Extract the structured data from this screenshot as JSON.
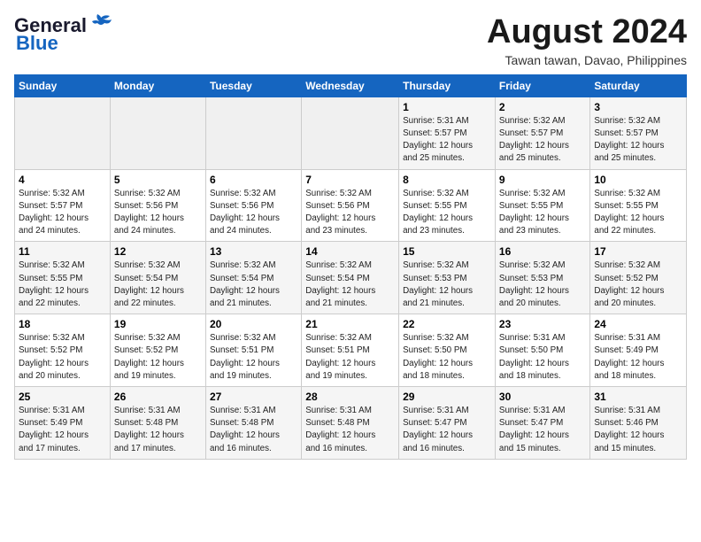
{
  "header": {
    "logo_general": "General",
    "logo_blue": "Blue",
    "month_year": "August 2024",
    "location": "Tawan tawan, Davao, Philippines"
  },
  "weekdays": [
    "Sunday",
    "Monday",
    "Tuesday",
    "Wednesday",
    "Thursday",
    "Friday",
    "Saturday"
  ],
  "weeks": [
    [
      {
        "day": "",
        "info": ""
      },
      {
        "day": "",
        "info": ""
      },
      {
        "day": "",
        "info": ""
      },
      {
        "day": "",
        "info": ""
      },
      {
        "day": "1",
        "info": "Sunrise: 5:31 AM\nSunset: 5:57 PM\nDaylight: 12 hours\nand 25 minutes."
      },
      {
        "day": "2",
        "info": "Sunrise: 5:32 AM\nSunset: 5:57 PM\nDaylight: 12 hours\nand 25 minutes."
      },
      {
        "day": "3",
        "info": "Sunrise: 5:32 AM\nSunset: 5:57 PM\nDaylight: 12 hours\nand 25 minutes."
      }
    ],
    [
      {
        "day": "4",
        "info": "Sunrise: 5:32 AM\nSunset: 5:57 PM\nDaylight: 12 hours\nand 24 minutes."
      },
      {
        "day": "5",
        "info": "Sunrise: 5:32 AM\nSunset: 5:56 PM\nDaylight: 12 hours\nand 24 minutes."
      },
      {
        "day": "6",
        "info": "Sunrise: 5:32 AM\nSunset: 5:56 PM\nDaylight: 12 hours\nand 24 minutes."
      },
      {
        "day": "7",
        "info": "Sunrise: 5:32 AM\nSunset: 5:56 PM\nDaylight: 12 hours\nand 23 minutes."
      },
      {
        "day": "8",
        "info": "Sunrise: 5:32 AM\nSunset: 5:55 PM\nDaylight: 12 hours\nand 23 minutes."
      },
      {
        "day": "9",
        "info": "Sunrise: 5:32 AM\nSunset: 5:55 PM\nDaylight: 12 hours\nand 23 minutes."
      },
      {
        "day": "10",
        "info": "Sunrise: 5:32 AM\nSunset: 5:55 PM\nDaylight: 12 hours\nand 22 minutes."
      }
    ],
    [
      {
        "day": "11",
        "info": "Sunrise: 5:32 AM\nSunset: 5:55 PM\nDaylight: 12 hours\nand 22 minutes."
      },
      {
        "day": "12",
        "info": "Sunrise: 5:32 AM\nSunset: 5:54 PM\nDaylight: 12 hours\nand 22 minutes."
      },
      {
        "day": "13",
        "info": "Sunrise: 5:32 AM\nSunset: 5:54 PM\nDaylight: 12 hours\nand 21 minutes."
      },
      {
        "day": "14",
        "info": "Sunrise: 5:32 AM\nSunset: 5:54 PM\nDaylight: 12 hours\nand 21 minutes."
      },
      {
        "day": "15",
        "info": "Sunrise: 5:32 AM\nSunset: 5:53 PM\nDaylight: 12 hours\nand 21 minutes."
      },
      {
        "day": "16",
        "info": "Sunrise: 5:32 AM\nSunset: 5:53 PM\nDaylight: 12 hours\nand 20 minutes."
      },
      {
        "day": "17",
        "info": "Sunrise: 5:32 AM\nSunset: 5:52 PM\nDaylight: 12 hours\nand 20 minutes."
      }
    ],
    [
      {
        "day": "18",
        "info": "Sunrise: 5:32 AM\nSunset: 5:52 PM\nDaylight: 12 hours\nand 20 minutes."
      },
      {
        "day": "19",
        "info": "Sunrise: 5:32 AM\nSunset: 5:52 PM\nDaylight: 12 hours\nand 19 minutes."
      },
      {
        "day": "20",
        "info": "Sunrise: 5:32 AM\nSunset: 5:51 PM\nDaylight: 12 hours\nand 19 minutes."
      },
      {
        "day": "21",
        "info": "Sunrise: 5:32 AM\nSunset: 5:51 PM\nDaylight: 12 hours\nand 19 minutes."
      },
      {
        "day": "22",
        "info": "Sunrise: 5:32 AM\nSunset: 5:50 PM\nDaylight: 12 hours\nand 18 minutes."
      },
      {
        "day": "23",
        "info": "Sunrise: 5:31 AM\nSunset: 5:50 PM\nDaylight: 12 hours\nand 18 minutes."
      },
      {
        "day": "24",
        "info": "Sunrise: 5:31 AM\nSunset: 5:49 PM\nDaylight: 12 hours\nand 18 minutes."
      }
    ],
    [
      {
        "day": "25",
        "info": "Sunrise: 5:31 AM\nSunset: 5:49 PM\nDaylight: 12 hours\nand 17 minutes."
      },
      {
        "day": "26",
        "info": "Sunrise: 5:31 AM\nSunset: 5:48 PM\nDaylight: 12 hours\nand 17 minutes."
      },
      {
        "day": "27",
        "info": "Sunrise: 5:31 AM\nSunset: 5:48 PM\nDaylight: 12 hours\nand 16 minutes."
      },
      {
        "day": "28",
        "info": "Sunrise: 5:31 AM\nSunset: 5:48 PM\nDaylight: 12 hours\nand 16 minutes."
      },
      {
        "day": "29",
        "info": "Sunrise: 5:31 AM\nSunset: 5:47 PM\nDaylight: 12 hours\nand 16 minutes."
      },
      {
        "day": "30",
        "info": "Sunrise: 5:31 AM\nSunset: 5:47 PM\nDaylight: 12 hours\nand 15 minutes."
      },
      {
        "day": "31",
        "info": "Sunrise: 5:31 AM\nSunset: 5:46 PM\nDaylight: 12 hours\nand 15 minutes."
      }
    ]
  ]
}
